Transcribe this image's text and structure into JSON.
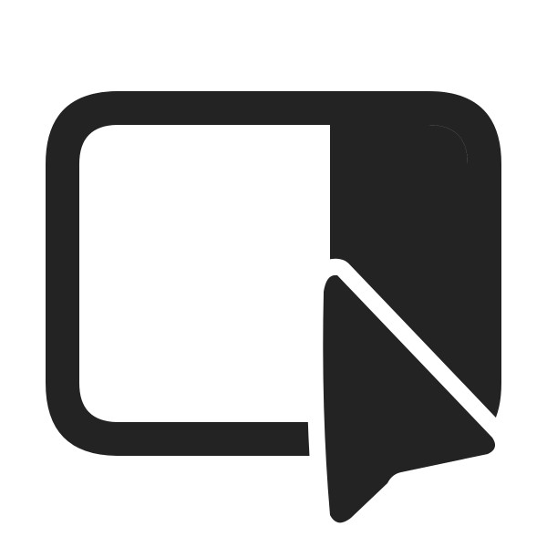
{
  "icon": {
    "name": "window-pointer-icon",
    "fill_color": "#232323",
    "background_color": "#ffffff"
  }
}
